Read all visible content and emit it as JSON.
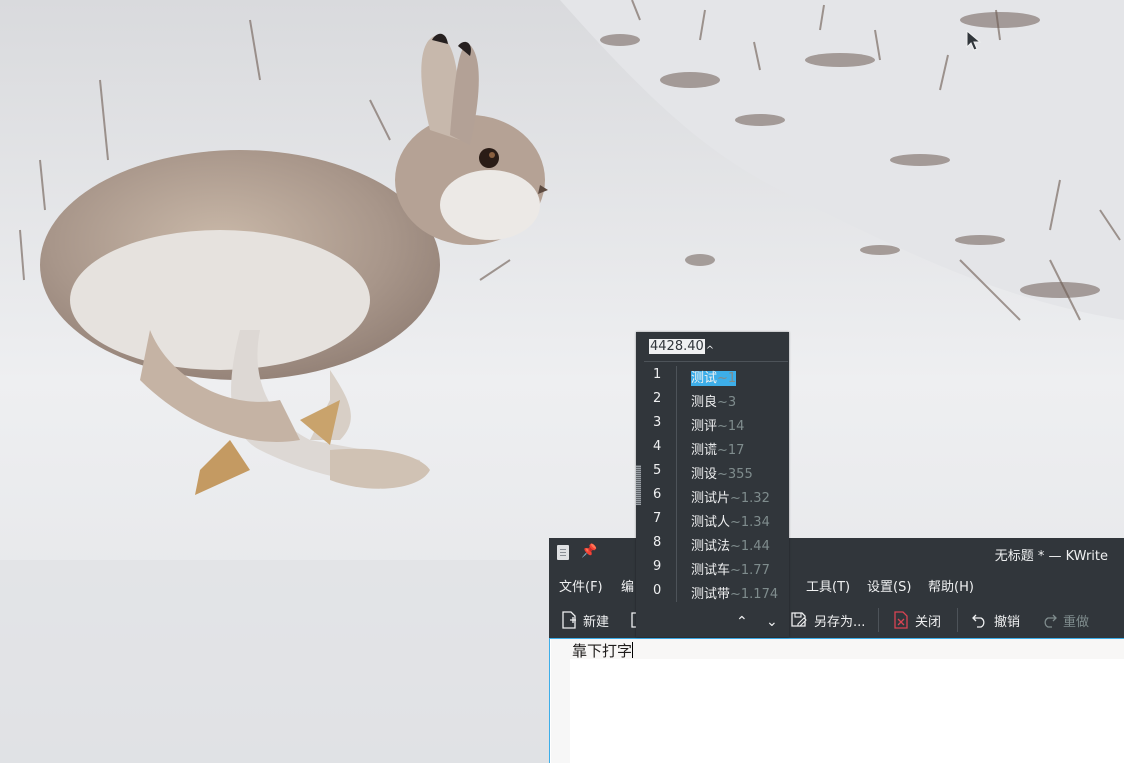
{
  "ime": {
    "preedit": "4428.40",
    "preedit_caret": "^",
    "candidates": [
      {
        "index": "1",
        "word": "测试",
        "hint": "~1",
        "selected": true
      },
      {
        "index": "2",
        "word": "测良",
        "hint": "~3"
      },
      {
        "index": "3",
        "word": "测评",
        "hint": "~14"
      },
      {
        "index": "4",
        "word": "测谎",
        "hint": "~17"
      },
      {
        "index": "5",
        "word": "测设",
        "hint": "~355"
      },
      {
        "index": "6",
        "word": "测试片",
        "hint": "~1.32"
      },
      {
        "index": "7",
        "word": "测试人",
        "hint": "~1.34"
      },
      {
        "index": "8",
        "word": "测试法",
        "hint": "~1.44"
      },
      {
        "index": "9",
        "word": "测试车",
        "hint": "~1.77"
      },
      {
        "index": "0",
        "word": "测试带",
        "hint": "~1.174"
      }
    ],
    "prev_page_icon": "chevron-up-icon",
    "next_page_icon": "chevron-down-icon"
  },
  "window": {
    "title": "无标题 * — KWrite",
    "app_icon": "document-icon",
    "pin_icon": "pin-icon"
  },
  "menubar": {
    "file": "文件(F)",
    "edit": "编",
    "tools": "工具(T)",
    "settings": "设置(S)",
    "help": "帮助(H)"
  },
  "toolbar": {
    "new": "新建",
    "save_as": "另存为...",
    "close": "关闭",
    "undo": "撤销",
    "redo": "重做"
  },
  "editor": {
    "text": "靠下打字"
  },
  "colors": {
    "panel_bg": "#31363b",
    "accent": "#3daee9",
    "text": "#eff0f1",
    "muted": "#7f8c8d",
    "close_icon": "#da4453"
  }
}
